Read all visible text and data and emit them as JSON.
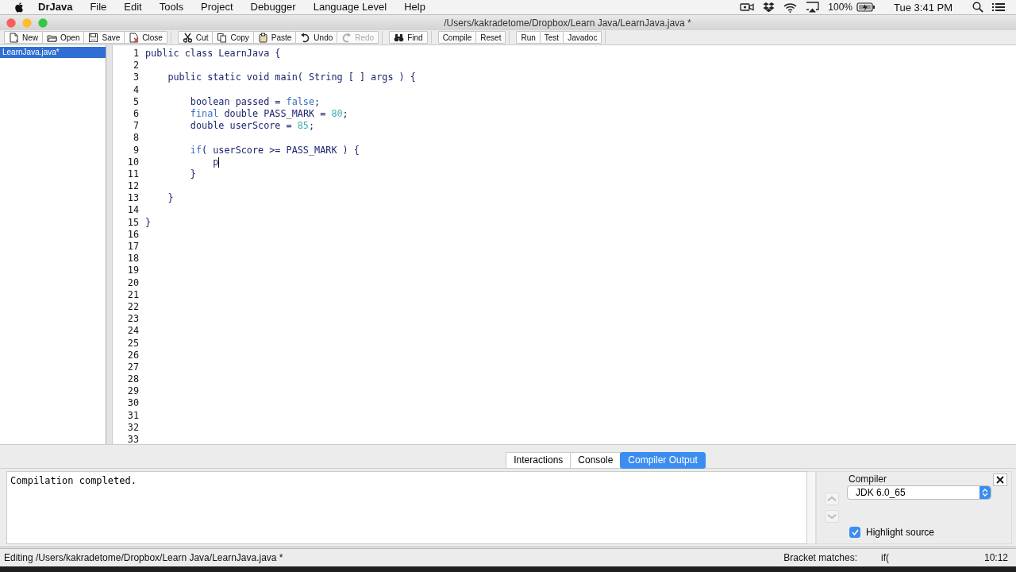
{
  "menu_bar": {
    "app_name": "DrJava",
    "menus": [
      "File",
      "Edit",
      "Tools",
      "Project",
      "Debugger",
      "Language Level",
      "Help"
    ],
    "battery_percent": "100%",
    "clock": "Tue 3:41 PM"
  },
  "window": {
    "title": "/Users/kakradetome/Dropbox/Learn Java/LearnJava.java *"
  },
  "toolbar": {
    "groups": [
      {
        "buttons": [
          {
            "label": "New",
            "kind": "new",
            "disabled": false
          },
          {
            "label": "Open",
            "kind": "open",
            "disabled": false
          },
          {
            "label": "Save",
            "kind": "save",
            "disabled": false
          },
          {
            "label": "Close",
            "kind": "close",
            "disabled": false
          }
        ]
      },
      {
        "buttons": [
          {
            "label": "Cut",
            "kind": "cut",
            "disabled": false
          },
          {
            "label": "Copy",
            "kind": "copy",
            "disabled": false
          },
          {
            "label": "Paste",
            "kind": "paste",
            "disabled": false
          },
          {
            "label": "Undo",
            "kind": "undo",
            "disabled": false
          },
          {
            "label": "Redo",
            "kind": "redo",
            "disabled": true
          }
        ]
      },
      {
        "buttons": [
          {
            "label": "Find",
            "kind": "find",
            "disabled": false
          }
        ]
      },
      {
        "buttons": [
          {
            "label": "Compile",
            "disabled": false
          },
          {
            "label": "Reset",
            "disabled": false
          }
        ]
      },
      {
        "buttons": [
          {
            "label": "Run",
            "disabled": false
          },
          {
            "label": "Test",
            "disabled": false
          },
          {
            "label": "Javadoc",
            "disabled": false
          }
        ]
      }
    ]
  },
  "sidebar": {
    "items": [
      {
        "label": "LearnJava.java*",
        "selected": true
      }
    ]
  },
  "editor": {
    "lines": [
      {
        "number": "1",
        "segments": [
          {
            "text": "public class LearnJava {",
            "kind": "plain"
          }
        ]
      },
      {
        "number": "2"
      },
      {
        "number": "3",
        "segments": [
          {
            "text": "    public static void main( String [ ] args ) {",
            "kind": "plain"
          }
        ]
      },
      {
        "number": "4"
      },
      {
        "number": "5",
        "segments": [
          {
            "text": "        boolean passed = ",
            "kind": "plain"
          },
          {
            "text": "false",
            "kind": "keyword"
          },
          {
            "text": ";",
            "kind": "plain"
          }
        ]
      },
      {
        "number": "6",
        "segments": [
          {
            "text": "        final",
            "kind": "keyword"
          },
          {
            "text": " double PASS_MARK = ",
            "kind": "plain"
          },
          {
            "text": "80",
            "kind": "number"
          },
          {
            "text": ";",
            "kind": "plain"
          }
        ]
      },
      {
        "number": "7",
        "segments": [
          {
            "text": "        double userScore = ",
            "kind": "plain"
          },
          {
            "text": "85",
            "kind": "number"
          },
          {
            "text": ";",
            "kind": "plain"
          }
        ]
      },
      {
        "number": "8"
      },
      {
        "number": "9",
        "segments": [
          {
            "text": "        if",
            "kind": "keyword"
          },
          {
            "text": "( userScore >= PASS_MARK ) {",
            "kind": "plain"
          }
        ]
      },
      {
        "number": "10",
        "segments": [
          {
            "text": "            p",
            "kind": "plain"
          }
        ],
        "caret": true
      },
      {
        "number": "11",
        "segments": [
          {
            "text": "        }",
            "kind": "plain"
          }
        ]
      },
      {
        "number": "12"
      },
      {
        "number": "13",
        "segments": [
          {
            "text": "    }",
            "kind": "plain"
          }
        ]
      },
      {
        "number": "14"
      },
      {
        "number": "15",
        "segments": [
          {
            "text": "}",
            "kind": "plain"
          }
        ]
      },
      {
        "number": "16"
      },
      {
        "number": "17"
      },
      {
        "number": "18"
      },
      {
        "number": "19"
      },
      {
        "number": "20"
      },
      {
        "number": "21"
      },
      {
        "number": "22"
      },
      {
        "number": "23"
      },
      {
        "number": "24"
      },
      {
        "number": "25"
      },
      {
        "number": "26"
      },
      {
        "number": "27"
      },
      {
        "number": "28"
      },
      {
        "number": "29"
      },
      {
        "number": "30"
      },
      {
        "number": "31"
      },
      {
        "number": "32"
      },
      {
        "number": "33"
      }
    ]
  },
  "bottom_panel": {
    "tabs": [
      {
        "label": "Interactions",
        "selected": false
      },
      {
        "label": "Console",
        "selected": false
      },
      {
        "label": "Compiler Output",
        "selected": true
      }
    ],
    "output": "Compilation completed.",
    "compiler": {
      "label": "Compiler",
      "value": "JDK 6.0_65"
    },
    "highlight_source": {
      "label": "Highlight source",
      "checked": true
    }
  },
  "status_bar": {
    "message": "Editing /Users/kakradetome/Dropbox/Learn Java/LearnJava.java *",
    "bracket_label": "Bracket matches:",
    "bracket_value": "if(",
    "position": "10:12"
  }
}
